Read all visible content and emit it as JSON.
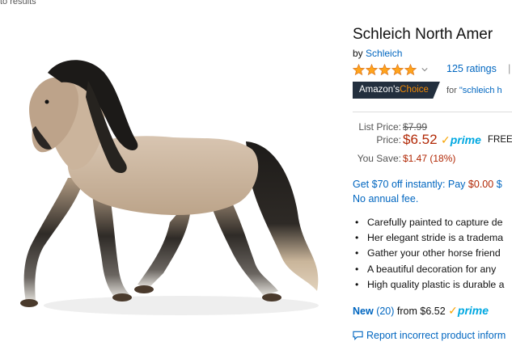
{
  "breadcrumb": {
    "text": "to results"
  },
  "product": {
    "image_alt_icon": "horse-figurine-image",
    "title": "Schleich North Amer",
    "by_prefix": "by",
    "brand": "Schleich",
    "rating": {
      "stars": 5,
      "count_text": "125 ratings",
      "separator": "|"
    },
    "choice": {
      "label_main": "Amazon's",
      "label_accent": "Choice",
      "for_text": "for",
      "query": "\"schleich h"
    }
  },
  "pricing": {
    "list_price_label": "List Price:",
    "list_price": "$7.99",
    "price_label": "Price:",
    "price": "$6.52",
    "prime_check": "✓",
    "prime_label": "prime",
    "free_text": "FREE",
    "save_label": "You Save:",
    "save_value": "$1.47 (18%)"
  },
  "promo": {
    "line1_text": "Get $70 off instantly: Pay",
    "line1_amount": "$0.00",
    "line1_tail": "$",
    "line2": "No annual fee."
  },
  "bullets": [
    "Carefully painted to capture de",
    "Her elegant stride is a tradema",
    "Gather your other horse friend",
    "A beautiful decoration for any",
    "High quality plastic is durable a"
  ],
  "offers": {
    "condition": "New",
    "count": "(20)",
    "from_text": "from $6.52",
    "prime_check": "✓",
    "prime_label": "prime"
  },
  "report": {
    "label": "Report incorrect product inform"
  },
  "colors": {
    "link": "#0066c0",
    "price": "#b12704",
    "star": "#ffa41c",
    "choice_bg": "#232f3e",
    "choice_accent": "#f08804",
    "prime_blue": "#00a8e1"
  }
}
